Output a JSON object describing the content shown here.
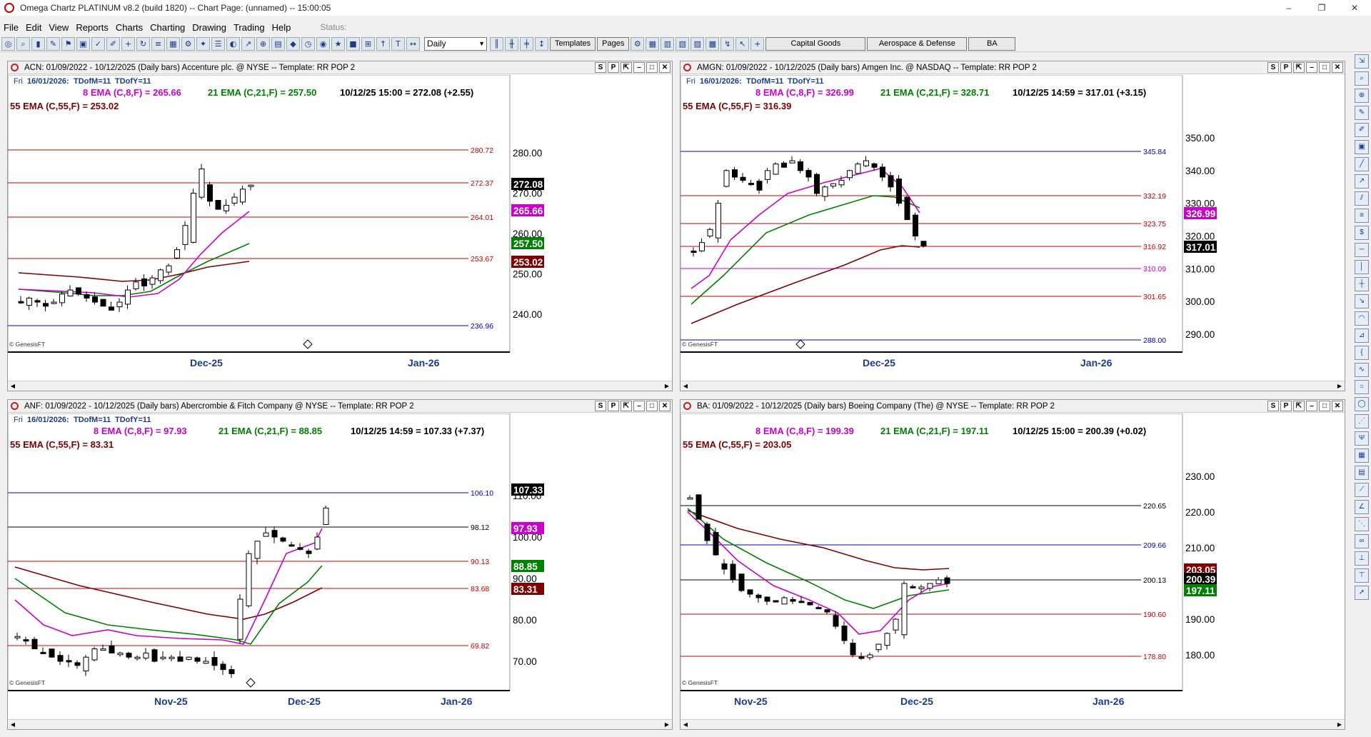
{
  "window": {
    "title": "Omega Chartz PLATINUM v8.2 (build 1820)  --  Chart Page: (unnamed)  --  15:00:05",
    "buttons": [
      "–",
      "❐",
      "✕"
    ]
  },
  "menu": {
    "items": [
      "File",
      "Edit",
      "View",
      "Reports",
      "Charts",
      "Charting",
      "Drawing",
      "Trading",
      "Help"
    ],
    "status_label": "Status:"
  },
  "toolbar": {
    "icons": [
      "world-icon",
      "magnify-icon",
      "bars-icon",
      "brush-icon",
      "flag-icon",
      "folder-icon",
      "check-icon",
      "pen-icon",
      "plus-icon",
      "cycle-icon",
      "list-icon",
      "grid-icon",
      "settings-icon",
      "compass-icon",
      "align-icon",
      "paint-icon",
      "trend-icon",
      "zoom-icon",
      "save-icon",
      "lock-icon",
      "clock-icon",
      "target-icon",
      "star-icon",
      "block-icon",
      "report-icon",
      "chart-icon",
      "text-icon",
      "tt-icon"
    ],
    "period_value": "Daily",
    "buttons": [
      "Templates",
      "Pages"
    ],
    "watchlists": [
      "Capital Goods",
      "Aerospace & Defense",
      "BA"
    ]
  },
  "panels": [
    {
      "id": "acn",
      "header": "ACN: 01/09/2022 - 10/12/2025  (Daily bars)   Accenture plc. @ NYSE  --  Template: RR POP 2",
      "date_line": {
        "day": "Fri",
        "date": "16/01/2026:",
        "tdofm": "TDofM=11",
        "tdofy": "TDofY=11"
      },
      "ema8": "8 EMA (C,8,F) = 265.66",
      "ema21": "21 EMA (C,21,F) = 257.50",
      "quote": "10/12/25 15:00 = 272.08 (+2.55)",
      "ema55": "55 EMA (C,55,F) = 253.02",
      "copyright": "© GenesisFT",
      "months": [
        "Dec-25",
        "Jan-26"
      ],
      "price_axis": [
        "280.00",
        "270.00",
        "260.00",
        "250.00",
        "240.00"
      ],
      "levels": [
        "280.72",
        "272.37",
        "264.01",
        "253.67",
        "236.96"
      ],
      "tags": [
        "272.08",
        "265.66",
        "257.50",
        "253.02"
      ]
    },
    {
      "id": "amgn",
      "header": "AMGN: 01/09/2022 - 10/12/2025  (Daily bars)   Amgen Inc. @ NASDAQ  --  Template: RR POP 2",
      "date_line": {
        "day": "Fri",
        "date": "16/01/2026:",
        "tdofm": "TDofM=11",
        "tdofy": "TDofY=11"
      },
      "ema8": "8 EMA (C,8,F) = 326.99",
      "ema21": "21 EMA (C,21,F) = 328.71",
      "quote": "10/12/25 14:59 = 317.01 (+3.15)",
      "ema55": "55 EMA (C,55,F) = 316.39",
      "copyright": "© GenesisFT",
      "months": [
        "Dec-25",
        "Jan-26"
      ],
      "price_axis": [
        "350.00",
        "340.00",
        "330.00",
        "320.00",
        "310.00",
        "300.00",
        "290.00"
      ],
      "levels": [
        "345.84",
        "332.19",
        "323.75",
        "316.92",
        "310.09",
        "301.65",
        "288.00"
      ],
      "tags": [
        "326.99",
        "317.01"
      ]
    },
    {
      "id": "anf",
      "header": "ANF: 01/09/2022 - 10/12/2025  (Daily bars)   Abercrombie & Fitch Company @ NYSE  --  Template: RR POP 2",
      "date_line": {
        "day": "Fri",
        "date": "16/01/2026:",
        "tdofm": "TDofM=11",
        "tdofy": "TDofY=11"
      },
      "ema8": "8 EMA (C,8,F) = 97.93",
      "ema21": "21 EMA (C,21,F) = 88.85",
      "quote": "10/12/25 14:59 = 107.33 (+7.37)",
      "ema55": "55 EMA (C,55,F) = 83.31",
      "copyright": "© GenesisFT",
      "months": [
        "Nov-25",
        "Dec-25",
        "Jan-26"
      ],
      "price_axis": [
        "110.00",
        "100.00",
        "90.00",
        "80.00",
        "70.00"
      ],
      "levels": [
        "106.10",
        "98.12",
        "90.13",
        "83.68",
        "69.82"
      ],
      "tags": [
        "107.33",
        "97.93",
        "88.85",
        "83.31"
      ]
    },
    {
      "id": "ba",
      "header": "BA: 01/09/2022 - 10/12/2025  (Daily bars)   Boeing Company (The) @ NYSE  --  Template: RR POP 2",
      "date_line": {
        "day": "",
        "date": "",
        "tdofm": "",
        "tdofy": ""
      },
      "ema8": "8 EMA (C,8,F) = 199.39",
      "ema21": "21 EMA (C,21,F) = 197.11",
      "quote": "10/12/25 15:00 = 200.39 (+0.02)",
      "ema55": "55 EMA (C,55,F) = 203.05",
      "copyright": "© GenesisFT",
      "months": [
        "Nov-25",
        "Dec-25",
        "Jan-26"
      ],
      "price_axis": [
        "230.00",
        "220.00",
        "210.00",
        "200.00",
        "190.00",
        "180.00"
      ],
      "levels": [
        "220.65",
        "209.66",
        "200.13",
        "190.60",
        "178.80"
      ],
      "tags": [
        "203.05",
        "200.39",
        "197.11"
      ]
    }
  ],
  "colors": {
    "ema8": "#cc00cc",
    "ema21": "#008000",
    "ema55": "#800000",
    "resistance": "#cc0000",
    "blue_level": "#0000cc",
    "black_level": "#000000"
  }
}
